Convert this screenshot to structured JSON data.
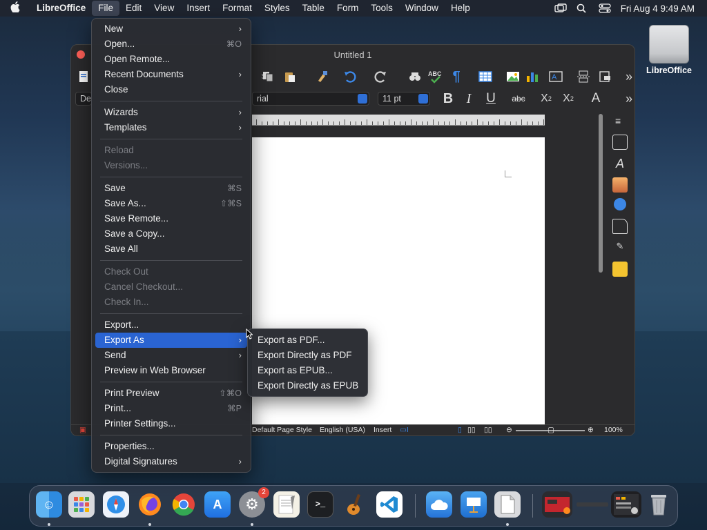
{
  "menubar": {
    "app_name": "LibreOffice",
    "items": [
      "File",
      "Edit",
      "View",
      "Insert",
      "Format",
      "Styles",
      "Table",
      "Form",
      "Tools",
      "Window",
      "Help"
    ],
    "clock": "Fri Aug 4  9:49 AM"
  },
  "desktop": {
    "drive_label": "LibreOffice"
  },
  "window": {
    "title": "Untitled 1",
    "paragraph_style": "De",
    "font_name": "rial",
    "font_size": "11 pt",
    "status": {
      "page_style": "Default Page Style",
      "language": "English (USA)",
      "mode": "Insert",
      "zoom": "100%"
    }
  },
  "file_menu": {
    "items": [
      {
        "label": "New",
        "submenu": true
      },
      {
        "label": "Open...",
        "shortcut": "⌘O"
      },
      {
        "label": "Open Remote..."
      },
      {
        "label": "Recent Documents",
        "submenu": true
      },
      {
        "label": "Close"
      },
      {
        "sep": true
      },
      {
        "label": "Wizards",
        "submenu": true
      },
      {
        "label": "Templates",
        "submenu": true
      },
      {
        "sep": true
      },
      {
        "label": "Reload",
        "disabled": true
      },
      {
        "label": "Versions...",
        "disabled": true
      },
      {
        "sep": true
      },
      {
        "label": "Save",
        "shortcut": "⌘S"
      },
      {
        "label": "Save As...",
        "shortcut": "⇧⌘S"
      },
      {
        "label": "Save Remote..."
      },
      {
        "label": "Save a Copy..."
      },
      {
        "label": "Save All"
      },
      {
        "sep": true
      },
      {
        "label": "Check Out",
        "disabled": true
      },
      {
        "label": "Cancel Checkout...",
        "disabled": true
      },
      {
        "label": "Check In...",
        "disabled": true
      },
      {
        "sep": true
      },
      {
        "label": "Export..."
      },
      {
        "label": "Export As",
        "submenu": true,
        "highlighted": true
      },
      {
        "label": "Send",
        "submenu": true
      },
      {
        "label": "Preview in Web Browser"
      },
      {
        "sep": true
      },
      {
        "label": "Print Preview",
        "shortcut": "⇧⌘O"
      },
      {
        "label": "Print...",
        "shortcut": "⌘P"
      },
      {
        "label": "Printer Settings..."
      },
      {
        "sep": true
      },
      {
        "label": "Properties..."
      },
      {
        "label": "Digital Signatures",
        "submenu": true
      }
    ]
  },
  "export_submenu": {
    "items": [
      "Export as PDF...",
      "Export Directly as PDF",
      "Export as EPUB...",
      "Export Directly as EPUB"
    ]
  },
  "dock": {
    "system_settings_badge": "2"
  },
  "colors": {
    "highlight": "#2a64d2",
    "menubar_bg": "#1f2530",
    "menu_bg": "#2a2c32"
  }
}
